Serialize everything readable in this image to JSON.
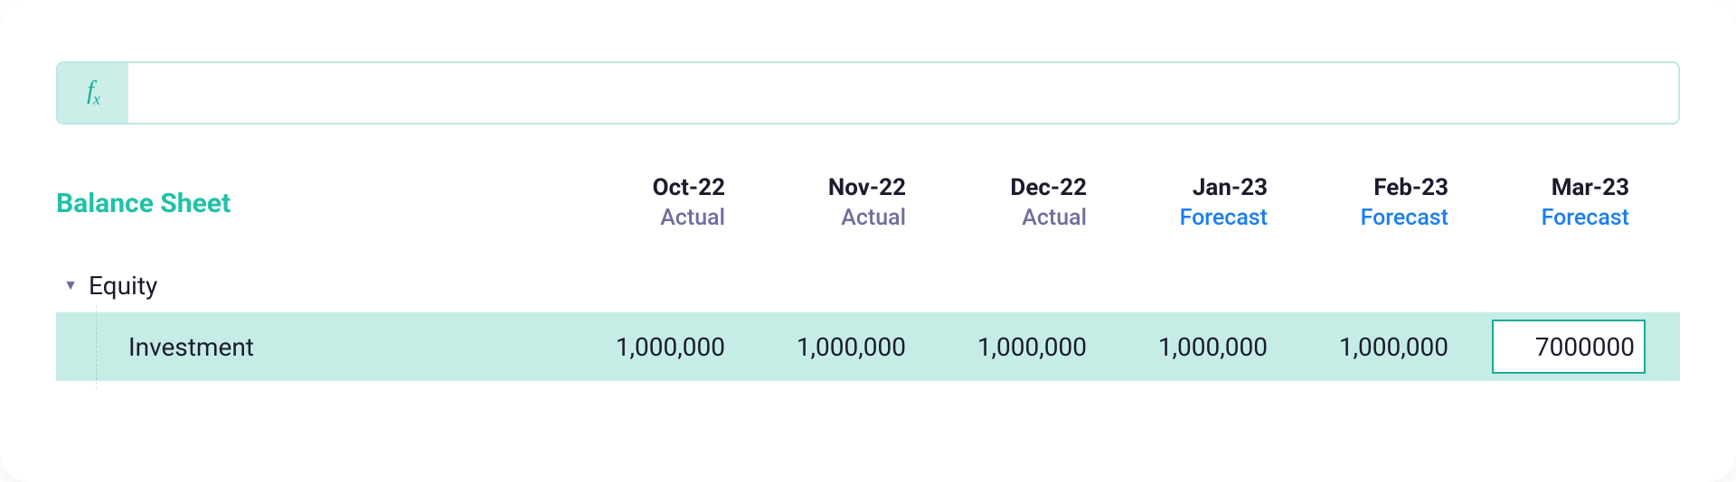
{
  "formula_bar": {
    "value": "",
    "placeholder": ""
  },
  "sheet_title": "Balance Sheet",
  "columns": [
    {
      "month": "Oct-22",
      "type": "Actual",
      "type_class": "actual"
    },
    {
      "month": "Nov-22",
      "type": "Actual",
      "type_class": "actual"
    },
    {
      "month": "Dec-22",
      "type": "Actual",
      "type_class": "actual"
    },
    {
      "month": "Jan-23",
      "type": "Forecast",
      "type_class": "forecast"
    },
    {
      "month": "Feb-23",
      "type": "Forecast",
      "type_class": "forecast"
    },
    {
      "month": "Mar-23",
      "type": "Forecast",
      "type_class": "forecast"
    }
  ],
  "section": {
    "label": "Equity"
  },
  "row": {
    "label": "Investment",
    "values": [
      "1,000,000",
      "1,000,000",
      "1,000,000",
      "1,000,000",
      "1,000,000"
    ],
    "editing_value": "7000000"
  }
}
